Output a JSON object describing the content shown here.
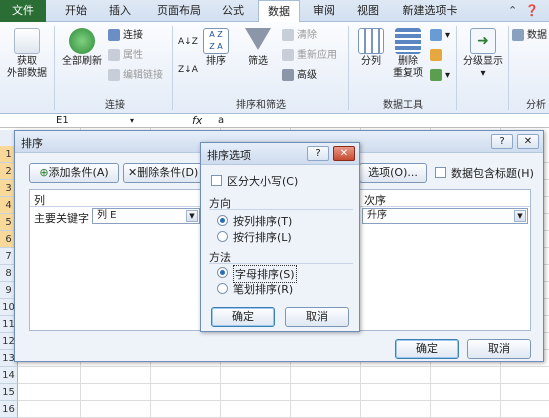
{
  "tabs": [
    "文件",
    "开始",
    "插入",
    "页面布局",
    "公式",
    "数据",
    "审阅",
    "视图",
    "新建选项卡"
  ],
  "active_tab": "数据",
  "ribbon": {
    "get_external": "获取\n外部数据",
    "refresh_all": "全部刷新",
    "connections": "连接",
    "properties": "属性",
    "edit_links": "编辑链接",
    "group_connect": "连接",
    "sort_az": "A↓Z",
    "sort": "排序",
    "filter": "筛选",
    "clear": "清除",
    "reapply": "重新应用",
    "advanced": "高级",
    "group_sortfilter": "排序和筛选",
    "split": "分列",
    "remove_dup": "删除\n重复项",
    "group_datatools": "数据工具",
    "outline": "分级显示",
    "data_analysis": "数据",
    "group_analysis": "分析"
  },
  "formula": {
    "name_box": "E1",
    "fx": "fx",
    "value": "a"
  },
  "rows": [
    "1",
    "2",
    "3",
    "4",
    "5",
    "6",
    "7",
    "8",
    "9",
    "10",
    "11",
    "12",
    "13",
    "14",
    "15",
    "16"
  ],
  "sort_dialog": {
    "title": "排序",
    "add_level": "添加条件(A)",
    "delete_level": "删除条件(D)",
    "options": "选项(O)...",
    "has_headers": "数据包含标题(H)",
    "col_header": "列",
    "order_header": "次序",
    "sort_by": "主要关键字",
    "column_value": "列 E",
    "order_value": "升序",
    "ok": "确定",
    "cancel": "取消"
  },
  "options_dialog": {
    "title": "排序选项",
    "case_sensitive": "区分大小写(C)",
    "direction": "方向",
    "top_to_bottom": "按列排序(T)",
    "left_to_right": "按行排序(L)",
    "method": "方法",
    "letter": "字母排序(S)",
    "stroke": "笔划排序(R)",
    "ok": "确定",
    "cancel": "取消"
  }
}
